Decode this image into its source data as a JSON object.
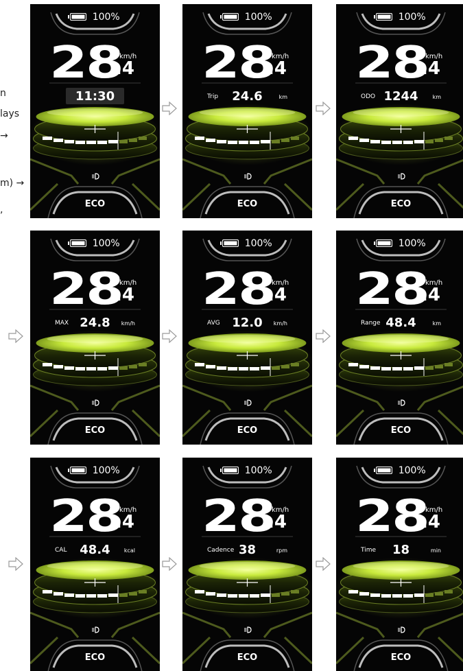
{
  "side_text": [
    "n",
    "lays",
    "→",
    "m) →",
    ","
  ],
  "panels": [
    {
      "battery": "100%",
      "speed": "28",
      "speed_decimal": ".4",
      "speed_unit": "km/h",
      "info_label": "",
      "info_value": "11:30",
      "info_unit": "",
      "mode": "ECO",
      "time_style": true
    },
    {
      "battery": "100%",
      "speed": "28",
      "speed_decimal": ".4",
      "speed_unit": "km/h",
      "info_label": "Trip",
      "info_value": "24.6",
      "info_unit": "km",
      "mode": "ECO"
    },
    {
      "battery": "100%",
      "speed": "28",
      "speed_decimal": ".4",
      "speed_unit": "km/h",
      "info_label": "ODO",
      "info_value": "1244",
      "info_unit": "km",
      "mode": "ECO"
    },
    {
      "battery": "100%",
      "speed": "28",
      "speed_decimal": ".4",
      "speed_unit": "km/h",
      "info_label": "MAX",
      "info_value": "24.8",
      "info_unit": "km/h",
      "mode": "ECO"
    },
    {
      "battery": "100%",
      "speed": "28",
      "speed_decimal": ".4",
      "speed_unit": "km/h",
      "info_label": "AVG",
      "info_value": "12.0",
      "info_unit": "km/h",
      "mode": "ECO"
    },
    {
      "battery": "100%",
      "speed": "28",
      "speed_decimal": ".4",
      "speed_unit": "km/h",
      "info_label": "Range",
      "info_value": "48.4",
      "info_unit": "km",
      "mode": "ECO"
    },
    {
      "battery": "100%",
      "speed": "28",
      "speed_decimal": ".4",
      "speed_unit": "km/h",
      "info_label": "CAL",
      "info_value": "48.4",
      "info_unit": "kcal",
      "mode": "ECO"
    },
    {
      "battery": "100%",
      "speed": "28",
      "speed_decimal": ".4",
      "speed_unit": "km/h",
      "info_label": "Cadence",
      "info_value": "38",
      "info_unit": "rpm",
      "mode": "ECO"
    },
    {
      "battery": "100%",
      "speed": "28",
      "speed_decimal": ".4",
      "speed_unit": "km/h",
      "info_label": "Time",
      "info_value": "18",
      "info_unit": "min",
      "mode": "ECO"
    }
  ],
  "colors": {
    "accent": "#c8ea3c",
    "accent_dark": "#7a9a1a",
    "panel_bg": "#050505",
    "text": "#ffffff"
  },
  "icons": {
    "arrow": "outline-right-arrow-icon",
    "battery": "battery-icon",
    "headlight": "headlight-icon"
  }
}
